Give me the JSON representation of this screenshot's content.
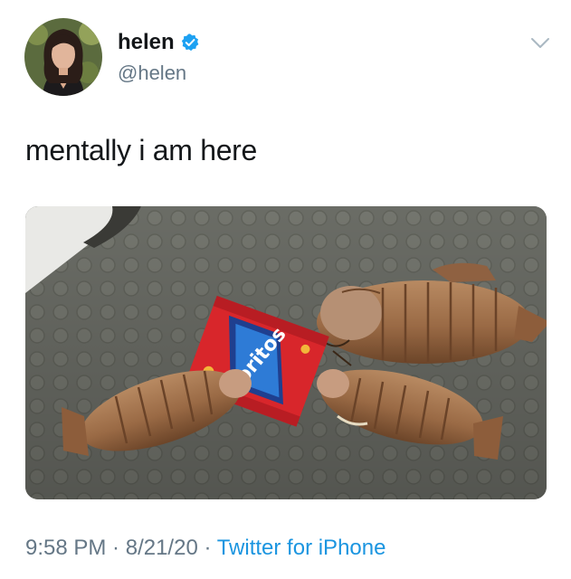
{
  "user": {
    "display_name": "helen",
    "handle": "@helen",
    "verified": true
  },
  "tweet": {
    "text": "mentally i am here"
  },
  "meta": {
    "time": "9:58 PM",
    "separator": " · ",
    "date": "8/21/20",
    "source": "Twitter for iPhone"
  },
  "media": {
    "bag_brand": "Doritos"
  },
  "colors": {
    "link": "#1b95e0",
    "secondary_text": "#657786",
    "verified_badge": "#1da1f2"
  },
  "icons": {
    "verified": "verified-badge-icon",
    "caret": "chevron-down-icon"
  }
}
